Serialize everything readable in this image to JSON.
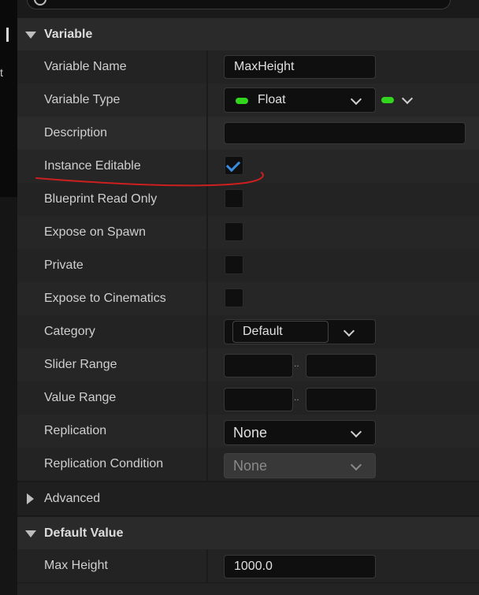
{
  "sections": {
    "variable": {
      "title": "Variable"
    },
    "default_value": {
      "title": "Default Value"
    }
  },
  "rows": {
    "variable_name": {
      "label": "Variable Name",
      "value": "MaxHeight"
    },
    "variable_type": {
      "label": "Variable Type",
      "value": "Float",
      "type_color": "#33d61e"
    },
    "description": {
      "label": "Description",
      "value": ""
    },
    "instance_editable": {
      "label": "Instance Editable",
      "checked": true
    },
    "blueprint_read_only": {
      "label": "Blueprint Read Only",
      "checked": false
    },
    "expose_on_spawn": {
      "label": "Expose on Spawn",
      "checked": false
    },
    "private": {
      "label": "Private",
      "checked": false
    },
    "expose_to_cinematics": {
      "label": "Expose to Cinematics",
      "checked": false
    },
    "category": {
      "label": "Category",
      "value": "Default"
    },
    "slider_range": {
      "label": "Slider Range",
      "separator": "..",
      "min": "",
      "max": ""
    },
    "value_range": {
      "label": "Value Range",
      "separator": "..",
      "min": "",
      "max": ""
    },
    "replication": {
      "label": "Replication",
      "value": "None"
    },
    "replication_condition": {
      "label": "Replication Condition",
      "value": "None"
    },
    "advanced": {
      "label": "Advanced"
    },
    "max_height": {
      "label": "Max Height",
      "value": "1000.0"
    }
  },
  "colors": {
    "accent_check": "#3a8dde",
    "annotation": "#cc1f1f",
    "float_type": "#33d61e"
  }
}
